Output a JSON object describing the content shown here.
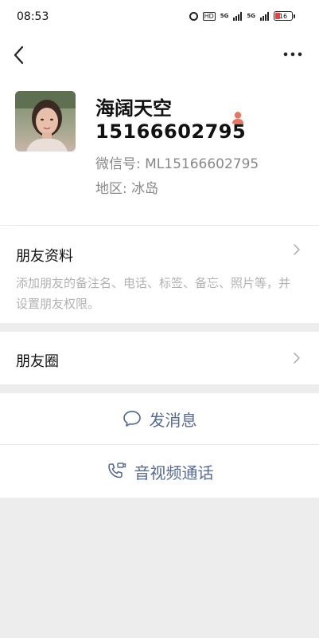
{
  "status_bar": {
    "time": "08:53",
    "network_badge": "HD",
    "network_label_1": "5G",
    "network_label_2": "5G",
    "battery": "16"
  },
  "profile": {
    "nickname": "海阔天空",
    "phone": "15166602795",
    "wechat_id": "微信号: ML15166602795",
    "region": "地区: 冰岛",
    "gender": "female"
  },
  "friend_info": {
    "title": "朋友资料",
    "description": "添加朋友的备注名、电话、标签、备忘、照片等，并设置朋友权限。"
  },
  "moments": {
    "title": "朋友圈"
  },
  "actions": {
    "send_message": "发消息",
    "video_call": "音视频通话"
  },
  "colors": {
    "link_blue": "#576b95",
    "gender_female": "#e8755f",
    "background": "#ededed"
  }
}
